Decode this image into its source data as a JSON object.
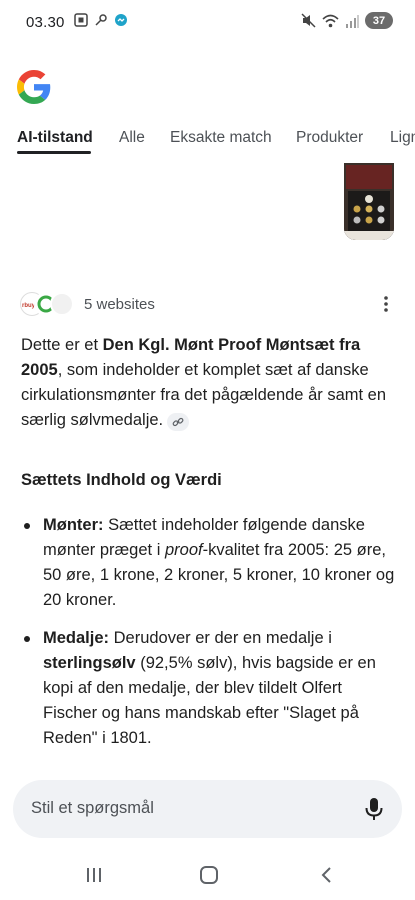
{
  "status_bar": {
    "time": "03.30",
    "battery": "37"
  },
  "tabs": [
    {
      "label": "AI-tilstand",
      "active": true
    },
    {
      "label": "Alle"
    },
    {
      "label": "Eksakte match"
    },
    {
      "label": "Produkter"
    },
    {
      "label": "Lign"
    }
  ],
  "sources": {
    "label": "5 websites",
    "favicon_text": "rbuy.dk"
  },
  "answer": {
    "intro_pre": "Dette er et ",
    "intro_bold": "Den Kgl. Mønt Proof Møntsæt fra 2005",
    "intro_post": ", som indeholder et komplet sæt af danske cirkulationsmønter fra det pågældende år samt en særlig sølvmedalje."
  },
  "section": {
    "title": "Sættets Indhold og Værdi"
  },
  "bullets": [
    {
      "label": "Mønter:",
      "text_pre": " Sættet indeholder følgende danske mønter præget i ",
      "italic": "proof",
      "text_post": "-kvalitet fra 2005: 25 øre, 50 øre, 1 krone, 2 kroner, 5 kroner, 10 kroner og 20 kroner."
    },
    {
      "label": "Medalje:",
      "text_pre": " Derudover er der en medalje i ",
      "bold": "sterlingsølv",
      "text_post": " (92,5% sølv), hvis bagside er en kopi af den medalje, der blev tildelt Olfert Fischer og hans mandskab efter \"Slaget på Reden\" i 1801."
    }
  ],
  "ask_bar": {
    "placeholder": "Stil et spørgsmål"
  },
  "colors": {
    "google_blue": "#4285F4",
    "google_red": "#EA4335",
    "google_yellow": "#FBBC05",
    "google_green": "#34A853"
  }
}
